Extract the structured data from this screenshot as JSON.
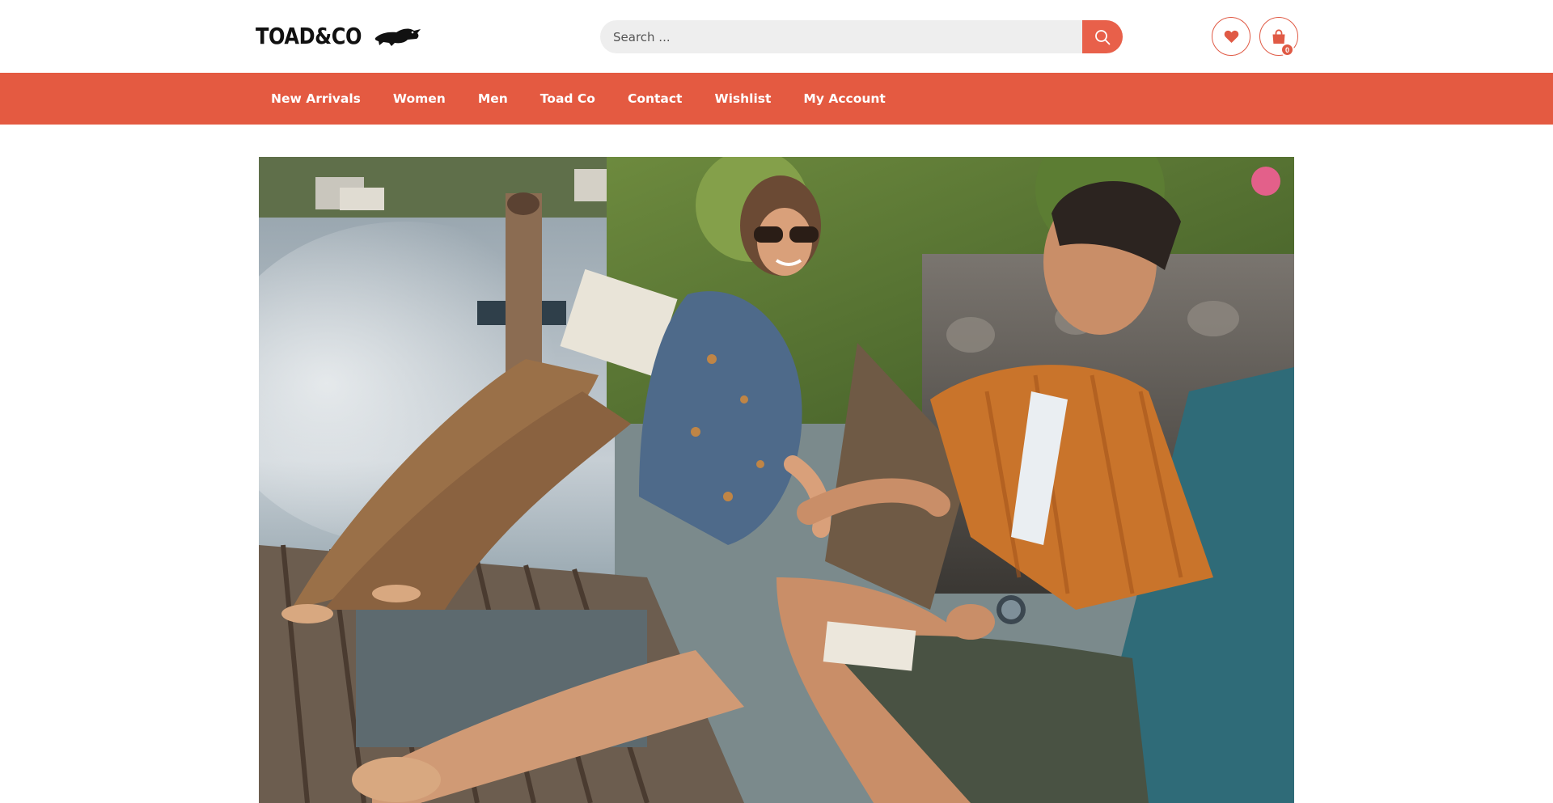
{
  "brand": {
    "logo_text": "TOAD&CO",
    "logo_icon": "toad-icon",
    "accent_color": "#e45a41"
  },
  "search": {
    "placeholder": "Search ...",
    "value": "",
    "button_icon": "search-icon"
  },
  "header_actions": {
    "wishlist_icon": "heart-icon",
    "cart_icon": "shopping-bag-icon",
    "cart_count": "0"
  },
  "nav": {
    "items": [
      {
        "label": "New Arrivals"
      },
      {
        "label": "Women"
      },
      {
        "label": "Men"
      },
      {
        "label": "Toad Co"
      },
      {
        "label": "Contact"
      },
      {
        "label": "Wishlist"
      },
      {
        "label": "My Account"
      }
    ]
  },
  "hero": {
    "image_alt": ""
  }
}
